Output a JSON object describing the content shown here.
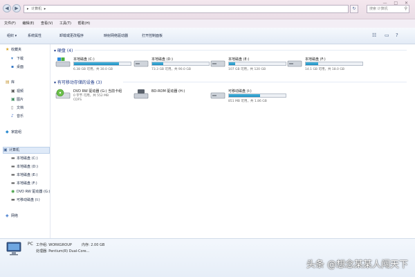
{
  "address": {
    "path": [
      "▸",
      "计算机",
      "▸"
    ]
  },
  "search": {
    "placeholder": "搜索 计算机"
  },
  "menu": [
    "文件(F)",
    "编辑(E)",
    "查看(V)",
    "工具(T)",
    "帮助(H)"
  ],
  "toolbar": [
    "组织 ▾",
    "系统属性",
    "卸载或更改程序",
    "映射网络驱动器",
    "打开控制面板"
  ],
  "sidebar": {
    "favorites": "收藏夹",
    "downloads": "下载",
    "desktop": "桌面",
    "library": "库",
    "video": "视频",
    "pictures": "图片",
    "documents": "文档",
    "music": "音乐",
    "homegroup": "家庭组",
    "computer": "计算机",
    "drive_c": "本地磁盘 (C:)",
    "drive_d": "本地磁盘 (D:)",
    "drive_e": "本地磁盘 (E:)",
    "drive_f": "本地磁盘 (F:)",
    "dvd": "DVD RW 驱动器 (G:)",
    "removable": "可移动磁盘 (I:)",
    "network": "网络"
  },
  "groups": {
    "hard_disks": "▾ 硬盘 (4)",
    "removable": "▾ 有可移动存储的设备 (3)"
  },
  "drives": [
    {
      "name": "本地磁盘 (C:)",
      "free": "6.38 GB 可用，共 30.0 GB",
      "used_fraction": 0.79
    },
    {
      "name": "本地磁盘 (D:)",
      "free": "73.3 GB 可用，共 90.0 GB",
      "used_fraction": 0.19
    },
    {
      "name": "本地磁盘 (E:)",
      "free": "107 GB 可用，共 120 GB",
      "used_fraction": 0.11
    },
    {
      "name": "本地磁盘 (F:)",
      "free": "14.1 GB 可用，共 18.0 GB",
      "used_fraction": 0.22
    }
  ],
  "devices": [
    {
      "name": "DVD RW 驱动器 (G:) 当前卡组",
      "sub1": "0 字节 可用，共 552 MB",
      "sub2": "CDFS"
    },
    {
      "name": "BD-ROM 驱动器 (H:)"
    },
    {
      "name": "可移动磁盘 (I:)",
      "free": "851 MB 可用，共 1.86 GB",
      "used_fraction": 0.55
    }
  ],
  "details": {
    "pc_name": "PC",
    "workgroup": "工作组: WORKGROUP",
    "memory": "内存: 2.00 GB",
    "processor": "处理器: Pentium(R) Dual-Core..."
  },
  "watermark": "头条 @想念某某人闯天下",
  "colors": {
    "accent": "#1f8fc1",
    "link": "#1e3a8a"
  }
}
